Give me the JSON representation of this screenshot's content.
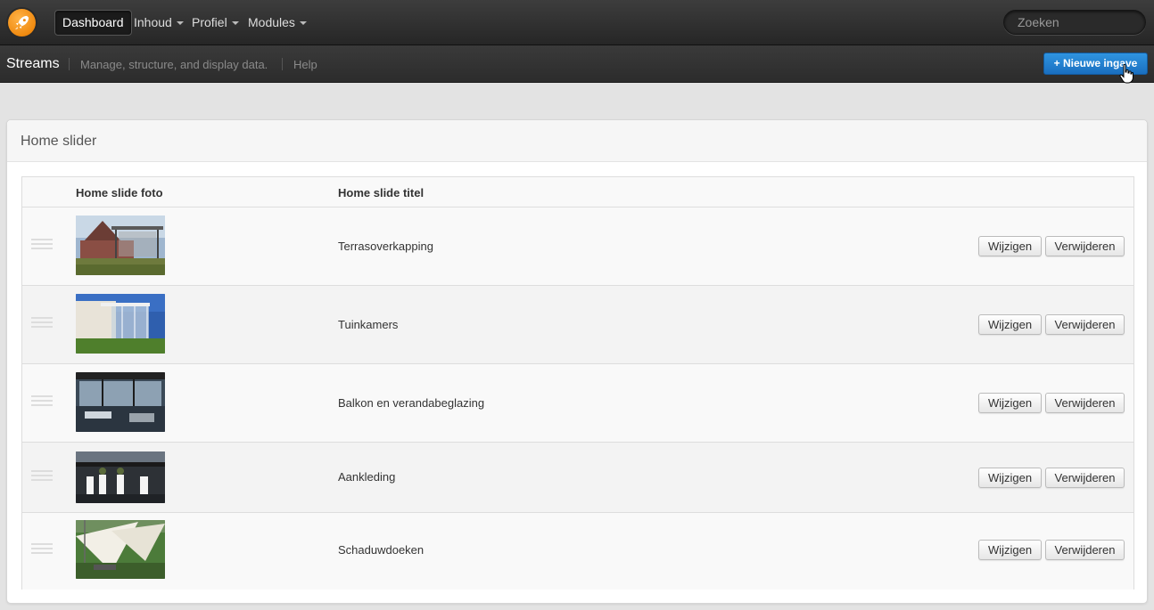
{
  "nav": {
    "items": [
      {
        "label": "Dashboard"
      },
      {
        "label": "Inhoud"
      },
      {
        "label": "Profiel"
      },
      {
        "label": "Modules"
      }
    ],
    "search_placeholder": "Zoeken"
  },
  "subbar": {
    "title": "Streams",
    "description": "Manage, structure, and display data.",
    "help": "Help",
    "new_button": "+ Nieuwe ingave"
  },
  "panel": {
    "title": "Home slider",
    "columns": [
      "Home slide foto",
      "Home slide titel"
    ],
    "rows": [
      {
        "title": "Terrasoverkapping",
        "edit": "Wijzigen",
        "delete": "Verwijderen"
      },
      {
        "title": "Tuinkamers",
        "edit": "Wijzigen",
        "delete": "Verwijderen"
      },
      {
        "title": "Balkon en verandabeglazing",
        "edit": "Wijzigen",
        "delete": "Verwijderen"
      },
      {
        "title": "Aankleding",
        "edit": "Wijzigen",
        "delete": "Verwijderen"
      },
      {
        "title": "Schaduwdoeken",
        "edit": "Wijzigen",
        "delete": "Verwijderen"
      }
    ]
  },
  "colors": {
    "accent_blue": "#1f7fd1",
    "logo_orange": "#f08a10",
    "topbar": "#2c2c2c"
  }
}
